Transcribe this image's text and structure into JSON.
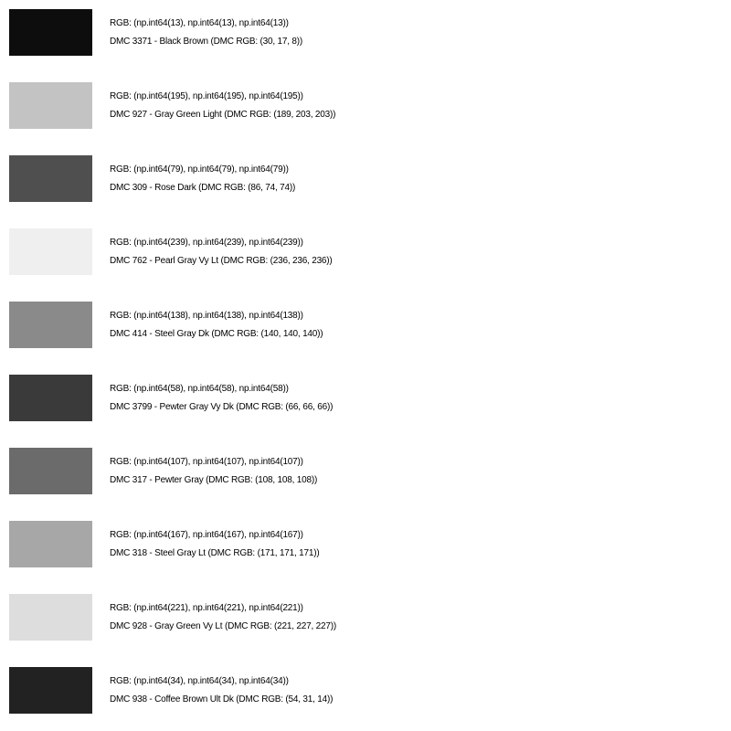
{
  "swatches": [
    {
      "color": "#0d0d0d",
      "rgb_text": "RGB: (np.int64(13), np.int64(13), np.int64(13))",
      "dmc_text": "DMC 3371 - Black Brown (DMC RGB: (30, 17, 8))"
    },
    {
      "color": "#c3c3c3",
      "rgb_text": "RGB: (np.int64(195), np.int64(195), np.int64(195))",
      "dmc_text": "DMC 927 - Gray Green Light (DMC RGB: (189, 203, 203))"
    },
    {
      "color": "#4f4f4f",
      "rgb_text": "RGB: (np.int64(79), np.int64(79), np.int64(79))",
      "dmc_text": "DMC 309 - Rose Dark (DMC RGB: (86, 74, 74))"
    },
    {
      "color": "#efefef",
      "rgb_text": "RGB: (np.int64(239), np.int64(239), np.int64(239))",
      "dmc_text": "DMC 762 - Pearl Gray Vy Lt (DMC RGB: (236, 236, 236))"
    },
    {
      "color": "#8a8a8a",
      "rgb_text": "RGB: (np.int64(138), np.int64(138), np.int64(138))",
      "dmc_text": "DMC 414 - Steel Gray Dk (DMC RGB: (140, 140, 140))"
    },
    {
      "color": "#3a3a3a",
      "rgb_text": "RGB: (np.int64(58), np.int64(58), np.int64(58))",
      "dmc_text": "DMC 3799 - Pewter Gray Vy Dk (DMC RGB: (66, 66, 66))"
    },
    {
      "color": "#6b6b6b",
      "rgb_text": "RGB: (np.int64(107), np.int64(107), np.int64(107))",
      "dmc_text": "DMC 317 - Pewter Gray (DMC RGB: (108, 108, 108))"
    },
    {
      "color": "#a7a7a7",
      "rgb_text": "RGB: (np.int64(167), np.int64(167), np.int64(167))",
      "dmc_text": "DMC 318 - Steel Gray Lt (DMC RGB: (171, 171, 171))"
    },
    {
      "color": "#dddddd",
      "rgb_text": "RGB: (np.int64(221), np.int64(221), np.int64(221))",
      "dmc_text": "DMC 928 - Gray Green Vy Lt (DMC RGB: (221, 227, 227))"
    },
    {
      "color": "#222222",
      "rgb_text": "RGB: (np.int64(34), np.int64(34), np.int64(34))",
      "dmc_text": "DMC 938 - Coffee Brown Ult Dk (DMC RGB: (54, 31, 14))"
    }
  ]
}
